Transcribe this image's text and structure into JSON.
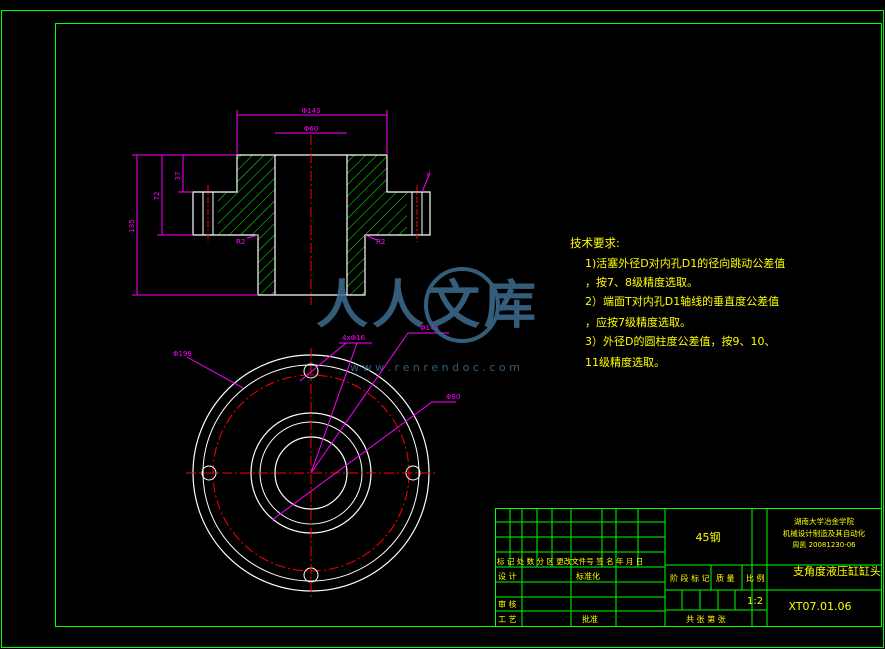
{
  "colors": {
    "frame": "#00ff00",
    "outline": "#ffffff",
    "hatch": "#00ff00",
    "center": "#ff0000",
    "dim": "#ff00ff",
    "note": "#ffff00",
    "watermark": "#3c6e91"
  },
  "dimensions": {
    "d143": "Φ143",
    "d60": "Φ60",
    "h37": "37",
    "h72": "72",
    "h135": "135",
    "r2a": "R2",
    "r2b": "R2",
    "chamfer": "√",
    "d198": "Φ198",
    "holes": "4xΦ16",
    "d143b": "Φ143",
    "d80": "Φ80"
  },
  "notes": {
    "title": "技术要求:",
    "lines": [
      "1)活塞外径D对内孔D1的径向跳动公差值",
      "，按7、8级精度选取。",
      "2）端面T对内孔D1轴线的垂直度公差值",
      "，应按7级精度选取。",
      "3）外径D的圆柱度公差值，按9、10、",
      "11级精度选取。"
    ]
  },
  "watermark": {
    "text": "人人文库",
    "url": "w w w . r e n r e n d o c . c o m"
  },
  "title_block": {
    "material": "45钢",
    "school_1": "湖南大学冶金学院",
    "school_2": "机械设计制造及其自动化",
    "school_3": "周凯 20081230-06",
    "part_name": "支角度液压缸缸头",
    "drawing_no": "XT07.01.06",
    "scale": "1:2",
    "row_labels": "标 记 处 数  分  区  更改文件号  签 名  年 月 日",
    "design": "设 计",
    "standard": "标准化",
    "review": "审 核",
    "process": "工 艺",
    "approve": "批准",
    "stage": "阶 段 标 记",
    "weight": "质 量",
    "ratio": "比 例",
    "sheets": "共    张  第    张"
  }
}
